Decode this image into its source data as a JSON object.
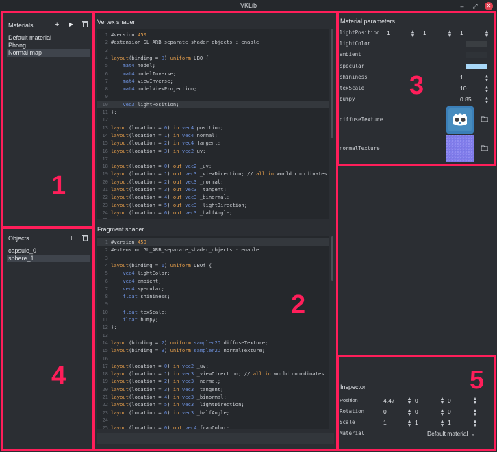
{
  "window": {
    "title": "VKLib",
    "minimize_glyph": "–",
    "maximize_glyph": "⤢",
    "close_glyph": "✕"
  },
  "colors": {
    "accent_highlight": "#ff1e5a",
    "background": "#2b2e33",
    "code_background": "#25282c"
  },
  "callouts": [
    "1",
    "2",
    "3",
    "4",
    "5"
  ],
  "materials": {
    "title": "Materials",
    "items": [
      "Default material",
      "Phong",
      "Normal map"
    ],
    "selected_index": 2,
    "add_icon": "+",
    "play_icon": "▶",
    "delete_icon": "trash"
  },
  "objects": {
    "title": "Objects",
    "items": [
      "capsule_0",
      "sphere_1"
    ],
    "selected_index": 1,
    "add_icon": "+",
    "delete_icon": "trash"
  },
  "vertex_shader": {
    "title": "Vertex shader",
    "current_line": 10,
    "lines": [
      "#version 450",
      "#extension GL_ARB_separate_shader_objects : enable",
      "",
      "layout(binding = 0) uniform UBO {",
      "    mat4 model;",
      "    mat4 modelInverse;",
      "    mat4 viewInverse;",
      "    mat4 modelViewProjection;",
      "",
      "    vec3 lightPosition;",
      "};",
      "",
      "layout(location = 0) in vec4 position;",
      "layout(location = 1) in vec4 normal;",
      "layout(location = 2) in vec4 tangent;",
      "layout(location = 3) in vec2 uv;",
      "",
      "layout(location = 0) out vec2 _uv;",
      "layout(location = 1) out vec3 _viewDirection; // all in world coordinates",
      "layout(location = 2) out vec3 _normal;",
      "layout(location = 3) out vec3 _tangent;",
      "layout(location = 4) out vec3 _binormal;",
      "layout(location = 5) out vec3 _lightDirection;",
      "layout(location = 6) out vec3 _halfAngle;",
      ""
    ]
  },
  "fragment_shader": {
    "title": "Fragment shader",
    "current_line": 1,
    "lines": [
      "#version 450",
      "#extension GL_ARB_separate_shader_objects : enable",
      "",
      "layout(binding = 1) uniform UBOf {",
      "    vec4 lightColor;",
      "    vec4 ambient;",
      "    vec4 specular;",
      "    float shininess;",
      "",
      "    float texScale;",
      "    float bumpy;",
      "};",
      "",
      "layout(binding = 2) uniform sampler2D diffuseTexture;",
      "layout(binding = 3) uniform sampler2D normalTexture;",
      "",
      "layout(location = 0) in vec2 _uv;",
      "layout(location = 1) in vec3 _viewDirection; // all in world coordinates",
      "layout(location = 2) in vec3 _normal;",
      "layout(location = 3) in vec3 _tangent;",
      "layout(location = 4) in vec3 _binormal;",
      "layout(location = 5) in vec3 _lightDirection;",
      "layout(location = 6) in vec3 _halfAngle;",
      "",
      "layout(location = 0) out vec4 fragColor;"
    ]
  },
  "material_parameters": {
    "title": "Material parameters",
    "lightPosition": {
      "label": "lightPosition",
      "values": [
        "1",
        "1",
        "1"
      ]
    },
    "lightColor": {
      "label": "lightColor",
      "color": "#3a3e42"
    },
    "ambient": {
      "label": "ambient",
      "color": "#2f3338"
    },
    "specular": {
      "label": "specular",
      "color": "#a8d8f8"
    },
    "shininess": {
      "label": "shininess",
      "value": "1"
    },
    "texScale": {
      "label": "texScale",
      "value": "10"
    },
    "bumpy": {
      "label": "bumpy",
      "value": "0.85"
    },
    "diffuseTexture": {
      "label": "diffuseTexture",
      "icon": "godot-logo-thumbnail"
    },
    "normalTexture": {
      "label": "normalTexture",
      "icon": "normal-map-thumbnail"
    }
  },
  "inspector": {
    "title": "Inspector",
    "position": {
      "label": "Position",
      "values": [
        "4.47",
        "0",
        "0"
      ]
    },
    "rotation": {
      "label": "Rotation",
      "values": [
        "0",
        "0",
        "0"
      ]
    },
    "scale": {
      "label": "Scale",
      "values": [
        "1",
        "1",
        "1"
      ]
    },
    "material": {
      "label": "Material",
      "value": "Default material"
    }
  }
}
